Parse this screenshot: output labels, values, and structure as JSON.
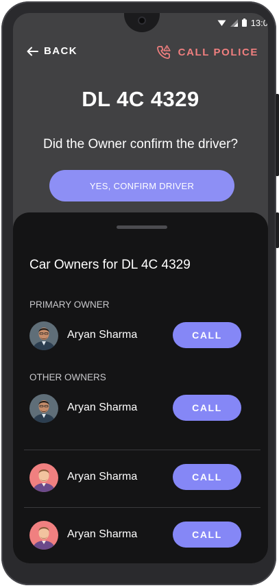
{
  "status": {
    "time": "13:0"
  },
  "header": {
    "back_label": "BACK",
    "call_police_label": "CALL POLICE"
  },
  "vehicle": {
    "plate": "DL 4C 4329"
  },
  "prompt": {
    "question": "Did the Owner confirm the driver?",
    "confirm_label": "YES, CONFIRM DRIVER"
  },
  "sheet": {
    "title": "Car Owners for DL 4C 4329",
    "primary_label": "PRIMARY OWNER",
    "others_label": "OTHER OWNERS",
    "owners": [
      {
        "name": "Aryan Sharma",
        "call_label": "CALL",
        "role": "primary"
      },
      {
        "name": "Aryan Sharma",
        "call_label": "CALL",
        "role": "other"
      },
      {
        "name": "Aryan Sharma",
        "call_label": "CALL",
        "role": "other"
      },
      {
        "name": "Aryan Sharma",
        "call_label": "CALL",
        "role": "other"
      }
    ]
  },
  "colors": {
    "accent": "#8587f6",
    "police": "#f07f7f",
    "sheet_bg": "#141415",
    "screen_bg": "#414143"
  }
}
